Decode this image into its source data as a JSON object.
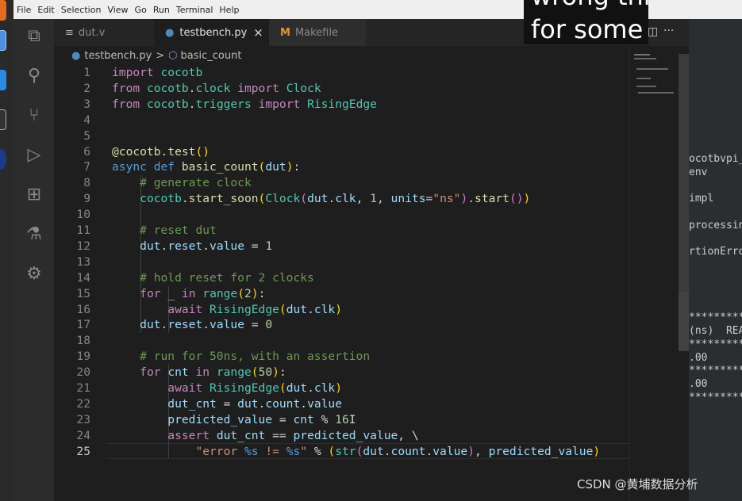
{
  "menu": [
    "File",
    "Edit",
    "Selection",
    "View",
    "Go",
    "Run",
    "Terminal",
    "Help"
  ],
  "tabs": [
    {
      "label": "dut.v",
      "icon": "lines-icon"
    },
    {
      "label": "testbench.py",
      "icon": "python-icon",
      "close": "×"
    },
    {
      "label": "Makefile",
      "icon": "M"
    }
  ],
  "breadcrumb": {
    "file": "testbench.py",
    "sep": ">",
    "symbol": "basic_count"
  },
  "editor_actions": {
    "split": "◫",
    "more": "···"
  },
  "code": [
    [
      [
        "import",
        "kw"
      ],
      [
        " "
      ],
      [
        "cocotb",
        "md"
      ]
    ],
    [
      [
        "from",
        "kw"
      ],
      [
        " "
      ],
      [
        "cocotb",
        "md"
      ],
      [
        "."
      ],
      [
        "clock",
        "md"
      ],
      [
        " "
      ],
      [
        "import",
        "kw"
      ],
      [
        " "
      ],
      [
        "Clock",
        "md"
      ]
    ],
    [
      [
        "from",
        "kw"
      ],
      [
        " "
      ],
      [
        "cocotb",
        "md"
      ],
      [
        "."
      ],
      [
        "triggers",
        "md"
      ],
      [
        " "
      ],
      [
        "import",
        "kw"
      ],
      [
        " "
      ],
      [
        "RisingEdge",
        "md"
      ]
    ],
    [],
    [],
    [
      [
        "@cocotb.test",
        "fn"
      ],
      [
        "()",
        "b1"
      ]
    ],
    [
      [
        "async",
        "bl"
      ],
      [
        " "
      ],
      [
        "def",
        "bl"
      ],
      [
        " "
      ],
      [
        "basic_count",
        "fn"
      ],
      [
        "(",
        "b1"
      ],
      [
        "dut",
        "vr"
      ],
      [
        ")",
        "b1"
      ],
      [
        ":"
      ]
    ],
    [
      [
        "    "
      ],
      [
        "# generate clock",
        "cm"
      ]
    ],
    [
      [
        "    "
      ],
      [
        "cocotb",
        "md"
      ],
      [
        "."
      ],
      [
        "start_soon",
        "fn"
      ],
      [
        "(",
        "b1"
      ],
      [
        "Clock",
        "md"
      ],
      [
        "(",
        "b2"
      ],
      [
        "dut",
        "vr"
      ],
      [
        "."
      ],
      [
        "clk",
        "vr"
      ],
      [
        ", "
      ],
      [
        "1",
        "nm"
      ],
      [
        ", "
      ],
      [
        "units",
        "vr"
      ],
      [
        "="
      ],
      [
        "\"ns\"",
        "st"
      ],
      [
        ")",
        "b2"
      ],
      [
        "."
      ],
      [
        "start",
        "fn"
      ],
      [
        "()",
        "b2"
      ],
      [
        ")",
        "b1"
      ]
    ],
    [],
    [
      [
        "    "
      ],
      [
        "# reset dut",
        "cm"
      ]
    ],
    [
      [
        "    "
      ],
      [
        "dut",
        "vr"
      ],
      [
        "."
      ],
      [
        "reset",
        "vr"
      ],
      [
        "."
      ],
      [
        "value",
        "vr"
      ],
      [
        " = "
      ],
      [
        "1",
        "nm"
      ]
    ],
    [],
    [
      [
        "    "
      ],
      [
        "# hold reset for 2 clocks",
        "cm"
      ]
    ],
    [
      [
        "    "
      ],
      [
        "for",
        "kw"
      ],
      [
        " "
      ],
      [
        "_",
        "vr"
      ],
      [
        " "
      ],
      [
        "in",
        "kw"
      ],
      [
        " "
      ],
      [
        "range",
        "md"
      ],
      [
        "(",
        "b1"
      ],
      [
        "2",
        "nm"
      ],
      [
        ")",
        "b1"
      ],
      [
        ":"
      ]
    ],
    [
      [
        "        "
      ],
      [
        "await",
        "kw"
      ],
      [
        " "
      ],
      [
        "RisingEdge",
        "md"
      ],
      [
        "(",
        "b1"
      ],
      [
        "dut",
        "vr"
      ],
      [
        "."
      ],
      [
        "clk",
        "vr"
      ],
      [
        ")",
        "b1"
      ]
    ],
    [
      [
        "    "
      ],
      [
        "dut",
        "vr"
      ],
      [
        "."
      ],
      [
        "reset",
        "vr"
      ],
      [
        "."
      ],
      [
        "value",
        "vr"
      ],
      [
        " = "
      ],
      [
        "0",
        "nm"
      ]
    ],
    [],
    [
      [
        "    "
      ],
      [
        "# run for 50ns, with an assertion",
        "cm"
      ]
    ],
    [
      [
        "    "
      ],
      [
        "for",
        "kw"
      ],
      [
        " "
      ],
      [
        "cnt",
        "vr"
      ],
      [
        " "
      ],
      [
        "in",
        "kw"
      ],
      [
        " "
      ],
      [
        "range",
        "md"
      ],
      [
        "(",
        "b1"
      ],
      [
        "50",
        "nm"
      ],
      [
        ")",
        "b1"
      ],
      [
        ":"
      ]
    ],
    [
      [
        "        "
      ],
      [
        "await",
        "kw"
      ],
      [
        " "
      ],
      [
        "RisingEdge",
        "md"
      ],
      [
        "(",
        "b1"
      ],
      [
        "dut",
        "vr"
      ],
      [
        "."
      ],
      [
        "clk",
        "vr"
      ],
      [
        ")",
        "b1"
      ]
    ],
    [
      [
        "        "
      ],
      [
        "dut_cnt",
        "vr"
      ],
      [
        " = "
      ],
      [
        "dut",
        "vr"
      ],
      [
        "."
      ],
      [
        "count",
        "vr"
      ],
      [
        "."
      ],
      [
        "value",
        "vr"
      ]
    ],
    [
      [
        "        "
      ],
      [
        "predicted_value",
        "vr"
      ],
      [
        " = "
      ],
      [
        "cnt",
        "vr"
      ],
      [
        " % "
      ],
      [
        "16",
        "nm"
      ],
      [
        "I",
        "op"
      ]
    ],
    [
      [
        "        "
      ],
      [
        "assert",
        "kw"
      ],
      [
        " "
      ],
      [
        "dut_cnt",
        "vr"
      ],
      [
        " == "
      ],
      [
        "predicted_value",
        "vr"
      ],
      [
        ", \\"
      ]
    ],
    [
      [
        "            "
      ],
      [
        "\"error ",
        "st"
      ],
      [
        "%s",
        "bl"
      ],
      [
        " != ",
        "st"
      ],
      [
        "%s",
        "bl"
      ],
      [
        "\"",
        "st"
      ],
      [
        " % "
      ],
      [
        "(",
        "b1"
      ],
      [
        "str",
        "md"
      ],
      [
        "(",
        "b2"
      ],
      [
        "dut",
        "vr"
      ],
      [
        "."
      ],
      [
        "count",
        "vr"
      ],
      [
        "."
      ],
      [
        "value",
        "vr"
      ],
      [
        ")",
        "b2"
      ],
      [
        ", "
      ],
      [
        "predicted_value",
        "vr"
      ],
      [
        ")",
        "b1"
      ]
    ]
  ],
  "terminal": [
    "ocotbvpi_",
    "env",
    "",
    "impl",
    "",
    "processin",
    "",
    "rtionErro",
    "",
    "",
    "",
    "",
    "*********",
    "(ns)  REA",
    "*********",
    ".00",
    "*********",
    ".00",
    "*********"
  ],
  "subtitle": {
    "line1": "wrong thing your",
    "line2": "for some"
  },
  "watermark": "CSDN @黄埔数据分析"
}
